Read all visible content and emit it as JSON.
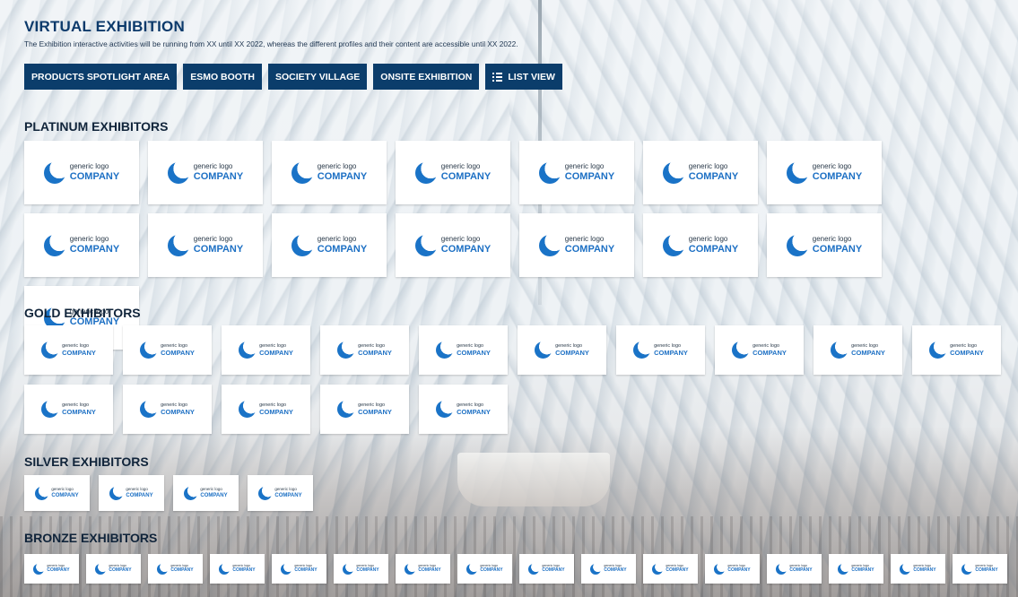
{
  "header": {
    "title": "VIRTUAL EXHIBITION",
    "subtitle": "The Exhibition interactive activities will be running from XX until XX 2022, whereas the different profiles and their content are accessible until XX 2022."
  },
  "nav": {
    "products_spotlight": "PRODUCTS SPOTLIGHT AREA",
    "esmo_booth": "ESMO BOOTH",
    "society_village": "SOCIETY VILLAGE",
    "onsite_exhibition": "ONSITE EXHIBITION",
    "list_view": "LIST VIEW",
    "list_view_icon": "list-icon"
  },
  "logo": {
    "small_text": "generic logo",
    "big_text": "COMPANY",
    "icon": "company-logo-icon",
    "color": "#1d70c4"
  },
  "sections": [
    {
      "key": "platinum",
      "title": "PLATINUM EXHIBITORS",
      "count": 15
    },
    {
      "key": "gold",
      "title": "GOLD EXHIBITORS",
      "count": 15
    },
    {
      "key": "silver",
      "title": "SILVER EXHIBITORS",
      "count": 4
    },
    {
      "key": "bronze",
      "title": "BRONZE EXHIBITORS",
      "count": 16
    }
  ],
  "colors": {
    "button_bg": "#0b3d6b",
    "title": "#0c3a6b",
    "tile_bg": "#ffffff"
  }
}
